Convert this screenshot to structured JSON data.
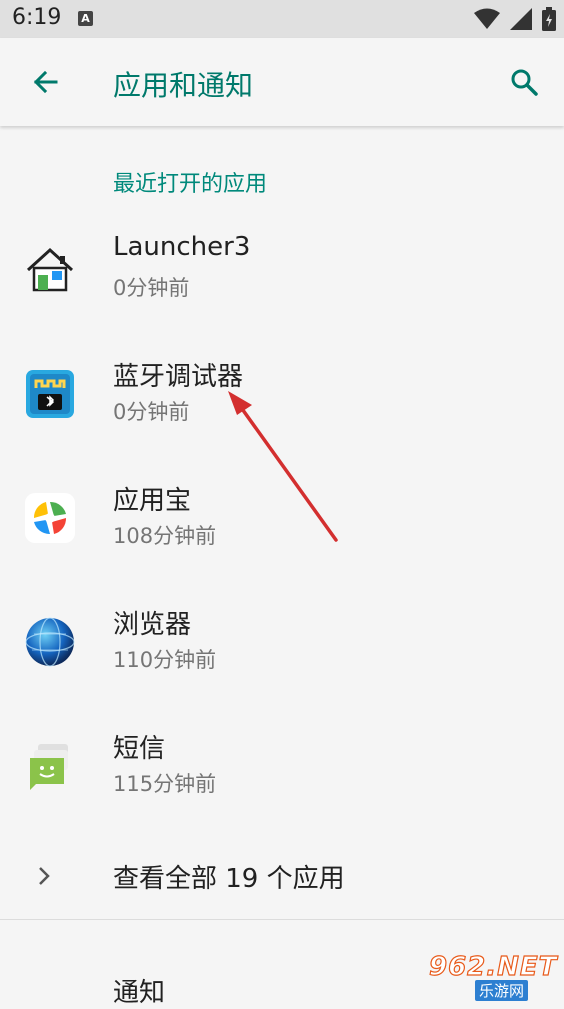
{
  "status_bar": {
    "time": "6:19",
    "notification_icon": "A",
    "icons": [
      "wifi-icon",
      "signal-icon",
      "battery-icon"
    ]
  },
  "toolbar": {
    "back_icon": "arrow-back-icon",
    "title": "应用和通知",
    "search_icon": "search-icon"
  },
  "recent_section": {
    "title": "最近打开的应用",
    "apps": [
      {
        "name": "Launcher3",
        "time": "0分钟前",
        "icon": "launcher-house-icon"
      },
      {
        "name": "蓝牙调试器",
        "time": "0分钟前",
        "icon": "bluetooth-debugger-icon"
      },
      {
        "name": "应用宝",
        "time": "108分钟前",
        "icon": "app-store-icon"
      },
      {
        "name": "浏览器",
        "time": "110分钟前",
        "icon": "browser-globe-icon"
      },
      {
        "name": "短信",
        "time": "115分钟前",
        "icon": "messaging-icon"
      }
    ]
  },
  "see_all": {
    "label": "查看全部 19 个应用",
    "icon": "chevron-right-icon"
  },
  "notifications": {
    "label": "通知"
  },
  "watermark": {
    "top": "962.NET",
    "bottom": "乐游网"
  },
  "colors": {
    "accent": "#00796b",
    "section": "#00897b",
    "annotation_arrow": "#d32f2f"
  }
}
